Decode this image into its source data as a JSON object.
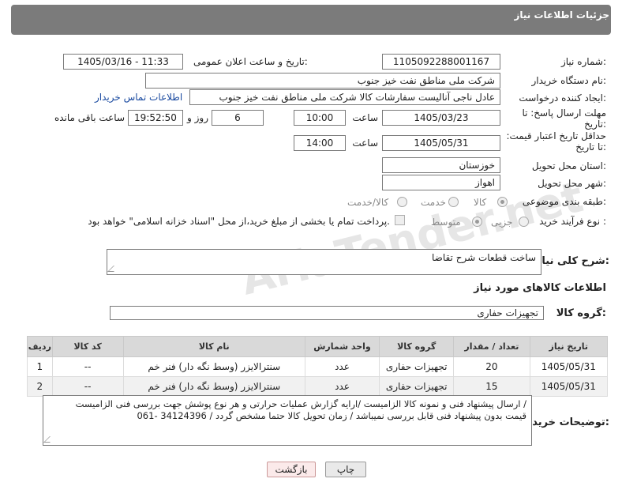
{
  "header": {
    "title": "جزئیات اطلاعات نیاز"
  },
  "fields": {
    "need_number_label": "شماره نیاز:",
    "need_number": "1105092288001167",
    "announce_label": "تاریخ و ساعت اعلان عمومی:",
    "announce_value": "1405/03/16 - 11:33",
    "buyer_label": "نام دستگاه خریدار:",
    "buyer_value": "شرکت ملی مناطق نفت خیز جنوب",
    "creator_label": "ایجاد کننده درخواست:",
    "creator_value": "عادل  ناجی آنالیست سفارشات کالا  شرکت ملی مناطق نفت خیز جنوب",
    "contact_link": "اطلاعات تماس خریدار",
    "deadline_label": "مهلت ارسال پاسخ: تا تاریخ:",
    "deadline_date": "1405/03/23",
    "time_label": "ساعت",
    "deadline_time": "10:00",
    "days_value": "6",
    "days_label": "روز و",
    "remain_time": "19:52:50",
    "remain_label": "ساعت باقی مانده",
    "validity_label": "حداقل تاریخ اعتبار قیمت: تا تاریخ:",
    "validity_date": "1405/05/31",
    "validity_time": "14:00",
    "province_label": "استان محل تحویل:",
    "province_value": "خوزستان",
    "city_label": "شهر محل تحویل:",
    "city_value": "اهواز",
    "category_label": "طبقه بندی موضوعی:",
    "category_options": [
      "کالا",
      "خدمت",
      "کالا/خدمت"
    ],
    "process_label": "نوع فرآیند خرید :",
    "process_options": [
      "جزیی",
      "متوسط"
    ],
    "payment_note": "پرداخت تمام یا بخشی از مبلغ خرید،از محل \"اسناد خزانه اسلامی\" خواهد بود."
  },
  "description": {
    "label": "شرح کلی نیاز:",
    "value": "ساخت قطعات شرح تقاضا"
  },
  "goods": {
    "section_title": "اطلاعات کالاهای مورد نیاز",
    "group_label": "گروه کالا:",
    "group_value": "تجهیزات حفاری"
  },
  "table": {
    "headers": [
      "ردیف",
      "کد کالا",
      "نام کالا",
      "واحد شمارش",
      "گروه کالا",
      "تعداد / مقدار",
      "تاریخ نیاز"
    ],
    "rows": [
      [
        "1",
        "--",
        "سنترالایزر (وسط نگه دار) فنر خم",
        "عدد",
        "تجهیزات حفاری",
        "20",
        "1405/05/31"
      ],
      [
        "2",
        "--",
        "سنترالایزر (وسط نگه دار) فنر خم",
        "عدد",
        "تجهیزات حفاری",
        "15",
        "1405/05/31"
      ]
    ]
  },
  "notes": {
    "label": "توضیحات خریدار:",
    "line1": "ارسال پیشنهاد فنی و نمونه کالا الزامیست /ارایه گزارش عملیات حرارتی و هر نوع پوشش جهت بررسی فنی الزامیست /",
    "line2": "قیمت بدون پیشنهاد فنی قابل بررسی نمیباشد / زمان تحویل کالا حتما مشخص گردد / 34124396 -061"
  },
  "buttons": {
    "print": "چاپ",
    "back": "بازگشت"
  },
  "watermark": "AriaTender.net"
}
